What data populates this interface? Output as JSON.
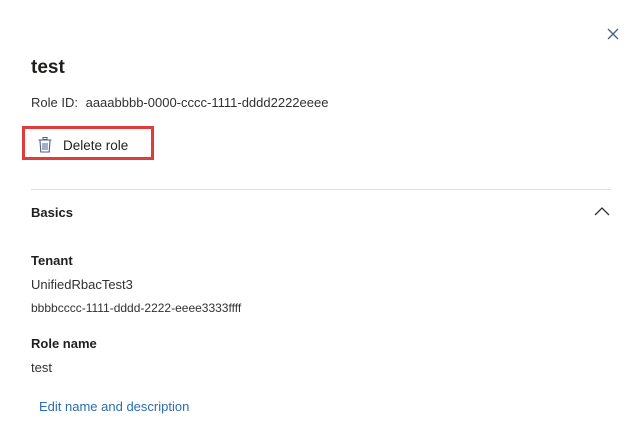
{
  "panel": {
    "title": "test",
    "role_id_label": "Role ID:",
    "role_id_value": "aaaabbbb-0000-cccc-1111-dddd2222eeee",
    "delete_label": "Delete role",
    "close_icon": "close-icon"
  },
  "basics": {
    "header": "Basics",
    "tenant_label": "Tenant",
    "tenant_name": "UnifiedRbacTest3",
    "tenant_id": "bbbbcccc-1111-dddd-2222-eeee3333ffff",
    "role_name_label": "Role name",
    "role_name_value": "test",
    "edit_link": "Edit name and description"
  },
  "colors": {
    "highlight": "#e03c3c",
    "link": "#2b6cb3",
    "close_icon": "#4a5f8a"
  }
}
